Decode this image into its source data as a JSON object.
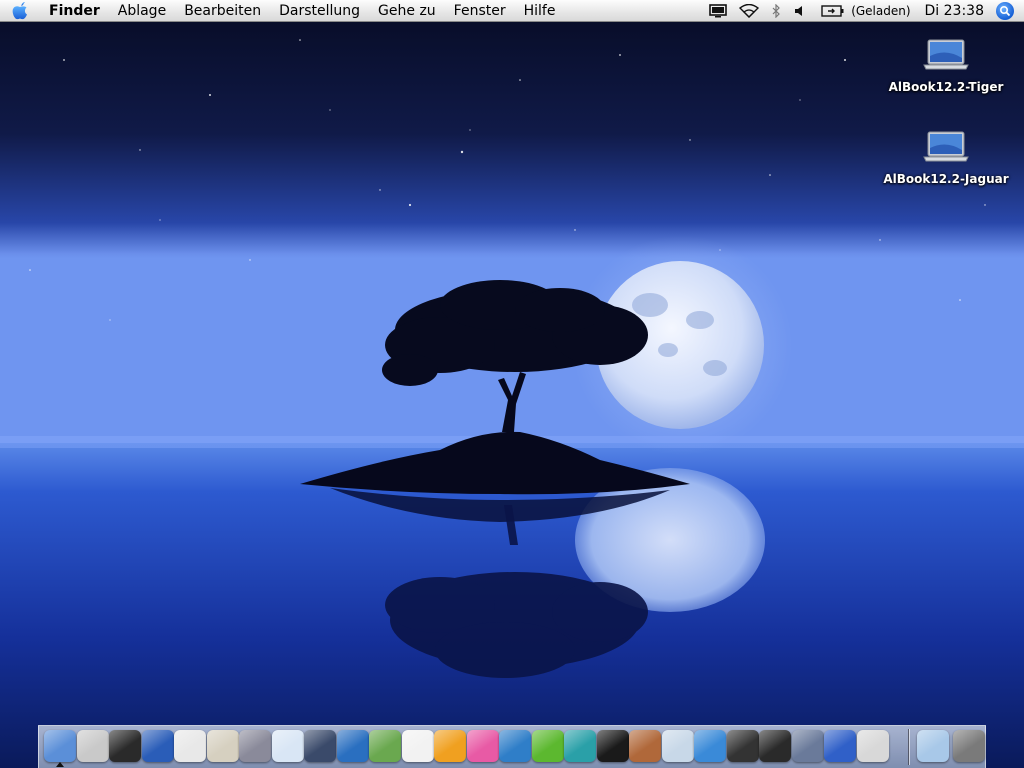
{
  "menubar": {
    "apple_icon": "apple-icon",
    "app_name": "Finder",
    "menus": [
      "Ablage",
      "Bearbeiten",
      "Darstellung",
      "Gehe zu",
      "Fenster",
      "Hilfe"
    ],
    "battery_status": "(Geladen)",
    "clock": "Di 23:38"
  },
  "desktop": {
    "icons": [
      {
        "label": "AlBook12.2-Tiger",
        "icon": "laptop-icon"
      },
      {
        "label": "AlBook12.2-Jaguar",
        "icon": "laptop-icon"
      }
    ]
  },
  "dock": {
    "apps": [
      {
        "icon": "finder-icon",
        "color": "#5b8fd8"
      },
      {
        "icon": "system-profiler-icon",
        "color": "#c9c9c9"
      },
      {
        "icon": "terminal-icon",
        "color": "#2a2a2a"
      },
      {
        "icon": "network-globe-icon",
        "color": "#2a5db8"
      },
      {
        "icon": "textedit-icon",
        "color": "#e8e8e8"
      },
      {
        "icon": "script-editor-icon",
        "color": "#d6d0c0"
      },
      {
        "icon": "graphic-tool-icon",
        "color": "#8a8a9a"
      },
      {
        "icon": "chart-app-icon",
        "color": "#d9e6f5"
      },
      {
        "icon": "qmaster-icon",
        "color": "#3a4a6a"
      },
      {
        "icon": "dreamweaver-icon",
        "color": "#2a6fc0"
      },
      {
        "icon": "fireworks-icon",
        "color": "#6aa84f"
      },
      {
        "icon": "acrobat-icon",
        "color": "#f2f2f2"
      },
      {
        "icon": "flower-app-icon",
        "color": "#f0a020"
      },
      {
        "icon": "butterfly-app-icon",
        "color": "#e85aa5"
      },
      {
        "icon": "feather-app-icon",
        "color": "#2f7ec8"
      },
      {
        "icon": "dreamweaver-dw-icon",
        "color": "#5cb82f"
      },
      {
        "icon": "flash-icon",
        "color": "#2aa0a8"
      },
      {
        "icon": "camera-lens-icon",
        "color": "#1a1a1a"
      },
      {
        "icon": "photo-app-icon",
        "color": "#b0683a"
      },
      {
        "icon": "music-cd-icon",
        "color": "#c8d8e8"
      },
      {
        "icon": "itunes-icon",
        "color": "#3a8ad8"
      },
      {
        "icon": "dvd-player-icon",
        "color": "#333333"
      },
      {
        "icon": "imovie-icon",
        "color": "#2a2a2a"
      },
      {
        "icon": "screen-sharing-icon",
        "color": "#6a7a9a"
      },
      {
        "icon": "yellow-figure-icon",
        "color": "#3060c8"
      },
      {
        "icon": "server-admin-icon",
        "color": "#d8d8d8"
      },
      {
        "icon": "documents-folder-icon",
        "color": "#a8c8e8"
      },
      {
        "icon": "trash-icon",
        "color": "#7a7a7a"
      }
    ]
  }
}
